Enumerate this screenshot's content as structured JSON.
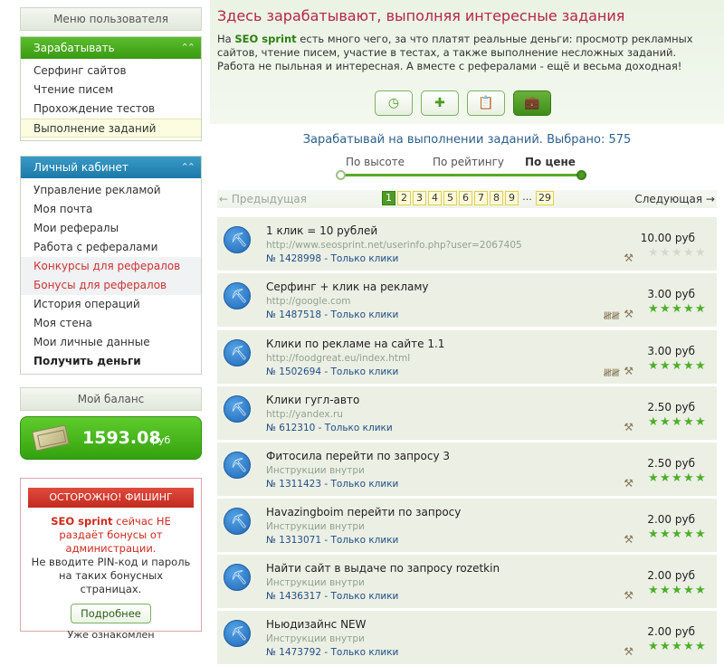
{
  "sidebar": {
    "menu_header": "Меню пользователя",
    "earn": {
      "title": "Зарабатывать",
      "items": [
        "Серфинг сайтов",
        "Чтение писем",
        "Прохождение тестов",
        "Выполнение заданий"
      ]
    },
    "cabinet": {
      "title": "Личный кабинет",
      "items": [
        "Управление рекламой",
        "Моя почта",
        "Мои рефералы",
        "Работа с рефералами",
        "Конкурсы для рефералов",
        "Бонусы для рефералов",
        "История операций",
        "Моя стена",
        "Мои личные данные",
        "Получить деньги"
      ]
    },
    "balance": {
      "header": "Мой баланс",
      "value": "1593.08",
      "unit": "руб"
    },
    "warning": {
      "title": "ОСТОРОЖНО! ФИШИНГ",
      "brand": "SEO sprint",
      "line1": " сейчас НЕ раздаёт бонусы от администрации.",
      "line2": "Не вводите PIN-код и пароль на таких бонусных страницах.",
      "more": "Подробнее",
      "ack": "Уже ознакомлен"
    }
  },
  "main": {
    "title": "Здесь зарабатывают, выполняя интересные задания",
    "intro_prefix": "На ",
    "intro_brand": "SEO sprint",
    "intro_text": " есть много чего, за что платят реальные деньги: просмотр рекламных сайтов, чтение писем, участие в тестах, а также выполнение несложных заданий. Работа не пыльная и интересная. А вместе с рефералами - ещё и весьма доходная!",
    "summary": "Зарабатывай на выполнении заданий. Выбрано: 575",
    "sorts": [
      "По высоте",
      "По рейтингу",
      "По цене"
    ],
    "pager": {
      "prev": "← Предыдущая",
      "next": "Следующая →",
      "pages": [
        "1",
        "2",
        "3",
        "4",
        "5",
        "6",
        "7",
        "8",
        "9",
        "...",
        "29"
      ]
    }
  },
  "tasks": [
    {
      "title": "1 клик = 10 рублей",
      "url": "http://www.seosprint.net/userinfo.php?user=2067405",
      "meta": "№ 1428998 - Только клики",
      "price": "10.00 руб",
      "rating": 0
    },
    {
      "title": "Серфинг + клик на рекламу",
      "url": "http://google.com",
      "meta": "№ 1487518 - Только клики",
      "price": "3.00 руб",
      "rating": 5
    },
    {
      "title": "Клики по рекламе на сайте 1.1",
      "url": "http://foodgreat.eu/index.html",
      "meta": "№ 1502694 - Только клики",
      "price": "3.00 руб",
      "rating": 5
    },
    {
      "title": "Клики гугл-авто",
      "url": "http://yandex.ru",
      "meta": "№ 612310 - Только клики",
      "price": "2.50 руб",
      "rating": 5
    },
    {
      "title": "Фитосила перейти по запросу 3",
      "url": "Инструкции внутри",
      "meta": "№ 1311423 - Только клики",
      "price": "2.50 руб",
      "rating": 5
    },
    {
      "title": "Havazingboim перейти по запросу",
      "url": "Инструкции внутри",
      "meta": "№ 1313071 - Только клики",
      "price": "2.00 руб",
      "rating": 5
    },
    {
      "title": "Найти сайт в выдаче по запросу rozetkin",
      "url": "Инструкции внутри",
      "meta": "№ 1436317 - Только клики",
      "price": "2.00 руб",
      "rating": 5
    },
    {
      "title": "Ньюдизайнс NEW",
      "url": "Инструкции внутри",
      "meta": "№ 1473792 - Только клики",
      "price": "2.00 руб",
      "rating": 5
    }
  ]
}
